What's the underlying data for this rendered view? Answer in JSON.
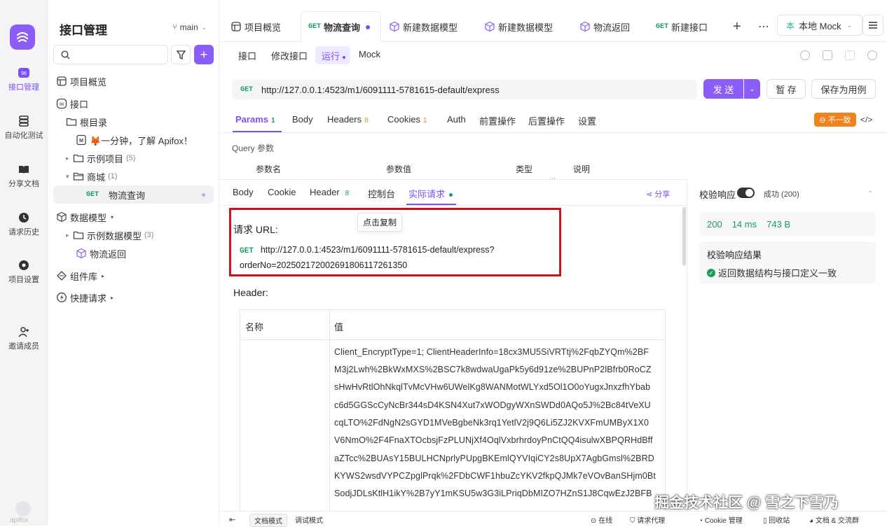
{
  "rail": {
    "items": [
      {
        "label": "接口管理",
        "icon": "api-icon"
      },
      {
        "label": "自动化测试",
        "icon": "automation-icon"
      },
      {
        "label": "分享文档",
        "icon": "book-icon"
      },
      {
        "label": "请求历史",
        "icon": "history-icon"
      },
      {
        "label": "项目设置",
        "icon": "settings-icon"
      },
      {
        "label": "邀请成员",
        "icon": "invite-icon"
      }
    ],
    "bottom_label": "apifox"
  },
  "tree": {
    "title": "接口管理",
    "branch": "main",
    "rows": [
      {
        "label": "项目概览"
      },
      {
        "label": "接口"
      },
      {
        "label": "根目录"
      },
      {
        "label": "🦊一分钟，了解 Apifox！"
      },
      {
        "label": "示例项目",
        "count": "(5)"
      },
      {
        "label": "商城",
        "count": "(1)"
      },
      {
        "method": "GET",
        "label": "物流查询"
      },
      {
        "label": "数据模型"
      },
      {
        "label": "示例数据模型",
        "count": "(3)"
      },
      {
        "label": "物流返回"
      },
      {
        "label": "组件库"
      },
      {
        "label": "快捷请求"
      }
    ]
  },
  "tabs": {
    "items": [
      {
        "label": "项目概览"
      },
      {
        "method": "GET",
        "label": "物流查询"
      },
      {
        "label": "新建数据模型"
      },
      {
        "label": "新建数据模型"
      },
      {
        "label": "物流返回"
      },
      {
        "method": "GET",
        "label": "新建接口"
      }
    ],
    "env": "本地 Mock"
  },
  "subtabs": [
    "接口",
    "修改接口",
    "运行",
    "Mock"
  ],
  "request": {
    "method": "GET",
    "url": "http://127.0.0.1:4523/m1/6091111-5781615-default/express",
    "send": "发 送",
    "save_temp": "暂 存",
    "save_case": "保存为用例"
  },
  "param_tabs": [
    {
      "label": "Params",
      "count": "1"
    },
    {
      "label": "Body"
    },
    {
      "label": "Headers",
      "count": "8"
    },
    {
      "label": "Cookies",
      "count": "1"
    },
    {
      "label": "Auth"
    },
    {
      "label": "前置操作"
    },
    {
      "label": "后置操作"
    },
    {
      "label": "设置"
    }
  ],
  "inconsistent_badge": "不一致",
  "query": {
    "title": "Query 参数",
    "cols": [
      "参数名",
      "参数值",
      "类型",
      "说明"
    ]
  },
  "resp_tabs": [
    {
      "label": "Body"
    },
    {
      "label": "Cookie"
    },
    {
      "label": "Header",
      "count": "8"
    },
    {
      "label": "控制台"
    },
    {
      "label": "实际请求"
    }
  ],
  "share": "分享",
  "tooltip": "点击复制",
  "actual": {
    "url_title": "请求 URL:",
    "method": "GET",
    "url_line1": "http://127.0.0.1:4523/m1/6091111-5781615-default/express?",
    "url_line2": "orderNo=202502172002691806117261350",
    "header_title": "Header:",
    "col_name": "名称",
    "col_value": "值",
    "header_value_lines": [
      "Client_EncryptType=1; ClientHeaderInfo=18cx3MU5SiVRTtj%2FqbZYQm%2BF",
      "M3j2Lwh%2BkWxMXS%2BSC7k8wdwaUgaPk5y6d91ze%2BUPnP2lBfrb0RoCZ",
      "sHwHvRtlOhNkqlTvMcVHw6UWelKg8WANMotWLYxd5Ol1O0oYugxJnxzfhYbab",
      "c6d5GGScCyNcBr344sD4KSN4Xut7xWODgyWXnSWDd0AQo5J%2Bc84tVeXU",
      "cqLTO%2FdNgN2sGYD1MVeBgbeNk3rq1YetlV2j9Q6Li5ZJ2KVXFmUMByX1X0",
      "V6NmO%2F4FnaXTOcbsjFzPLUNjXf4OqlVxbrhrdoyPnCtQQ4isulwXBPQRHdBff",
      "aZTcc%2BUAsY15BULHCNprlyPUpgBKEmlQYVIqiCY2s8UpX7AgbGmsl%2BRD",
      "KYWS2wsdVYPCZpglPrqk%2FDbCWF1hbuZcYKV2fkpQJMk7eVOvBanSHjm0Bt",
      "SodjJDLsKtlH1ikY%2B7yY1mKSU5w3G3iLPriqDbMIZO7HZnS1J8CqwEzJ2BFB"
    ]
  },
  "validation": {
    "label": "校验响应",
    "status": "成功 (200)",
    "code": "200",
    "time": "14 ms",
    "size": "743 B",
    "result_title": "校验响应结果",
    "result_text": "返回数据结构与接口定义一致"
  },
  "footer": {
    "doc_mode": "文档模式",
    "debug_mode": "调试模式",
    "online": "在线",
    "proxy": "请求代理",
    "cookie": "Cookie 管理",
    "recycle": "回收站",
    "community": "文档 & 交流群"
  },
  "watermark": "掘金技术社区 @ 雪之下雪乃",
  "colors": {
    "accent": "#7c4dff",
    "highlight_border": "#d0101b",
    "get": "#1a9c5b",
    "orange": "#f0831e"
  }
}
